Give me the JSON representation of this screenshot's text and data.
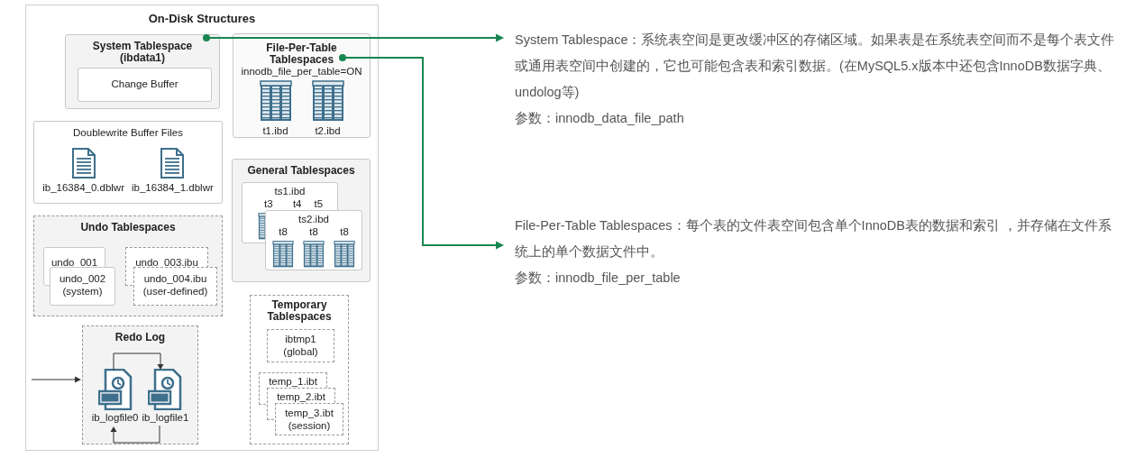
{
  "diagram": {
    "title": "On-Disk Structures",
    "system_tablespace": {
      "title": "System Tablespace",
      "subtitle": "(ibdata1)",
      "inner": "Change Buffer"
    },
    "file_per_table": {
      "title": "File-Per-Table Tablespaces",
      "setting": "innodb_file_per_table=ON",
      "files": [
        "t1.ibd",
        "t2.ibd"
      ]
    },
    "doublewrite": {
      "title": "Doublewrite Buffer Files",
      "files": [
        "ib_16384_0.dblwr",
        "ib_16384_1.dblwr"
      ]
    },
    "general": {
      "title": "General Tablespaces",
      "files": [
        {
          "name": "ts1.ibd",
          "tables": [
            "t3",
            "t4",
            "t5"
          ]
        },
        {
          "name": "ts2.ibd",
          "tables": [
            "t8",
            "t8",
            "t8"
          ]
        }
      ]
    },
    "undo": {
      "title": "Undo Tablespaces",
      "groups": [
        {
          "kind": "solid",
          "back": "undo_001",
          "front": "undo_002",
          "note": "(system)"
        },
        {
          "kind": "dashed",
          "back": "undo_003.ibu",
          "front": "undo_004.ibu",
          "note": "(user-defined)"
        }
      ]
    },
    "redo": {
      "title": "Redo Log",
      "files": [
        "ib_logfile0",
        "ib_logfile1"
      ]
    },
    "temporary": {
      "title": "Temporary Tablespaces",
      "global": {
        "name": "ibtmp1",
        "note": "(global)"
      },
      "session": {
        "files": [
          "temp_1.ibt",
          "temp_2.ibt"
        ],
        "name": "temp_3.ibt",
        "note": "(session)"
      }
    }
  },
  "notes": [
    {
      "text": "System Tablespace：系统表空间是更改缓冲区的存储区域。如果表是在系统表空间而不是每个表文件或通用表空间中创建的，它也可能包含表和索引数据。(在MySQL5.x版本中还包含InnoDB数据字典、undolog等)",
      "param": "参数：innodb_data_file_path"
    },
    {
      "text": "File-Per-Table Tablespaces：每个表的文件表空间包含单个InnoDB表的数据和索引 ，并存储在文件系统上的单个数据文件中。",
      "param": "参数：innodb_file_per_table"
    }
  ]
}
